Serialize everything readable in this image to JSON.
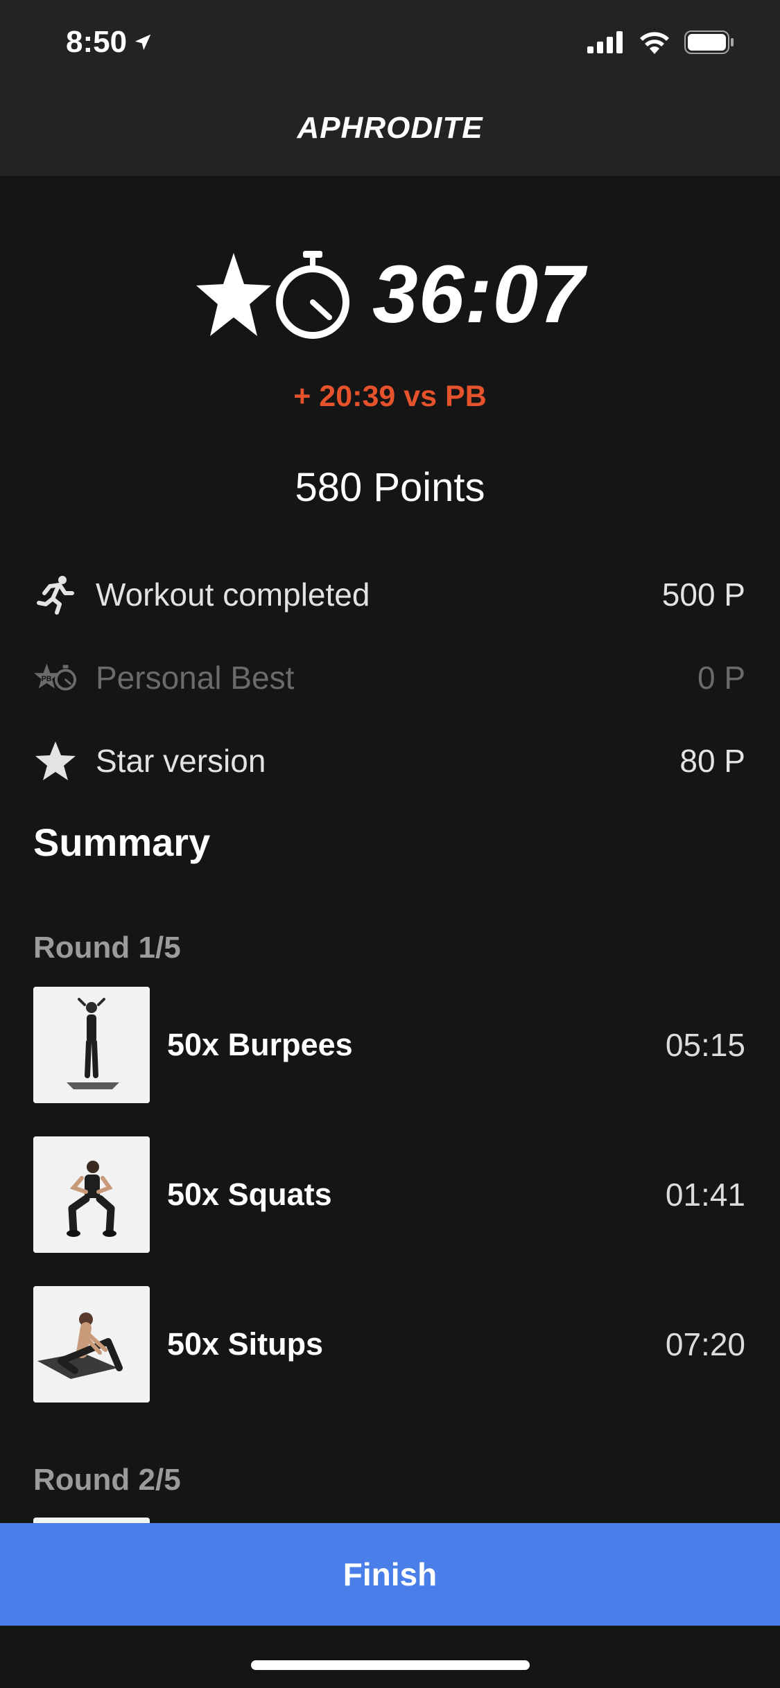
{
  "status_bar": {
    "time": "8:50"
  },
  "nav": {
    "title": "APHRODITE"
  },
  "result": {
    "time": "36:07",
    "vs_pb": "+ 20:39 vs PB",
    "points_total": "580 Points"
  },
  "points": [
    {
      "icon": "running-person-icon",
      "label": "Workout completed",
      "value": "500 P",
      "active": true
    },
    {
      "icon": "personal-best-icon",
      "label": "Personal Best",
      "value": "0 P",
      "active": false
    },
    {
      "icon": "star-icon",
      "label": "Star version",
      "value": "80 P",
      "active": true
    }
  ],
  "summary": {
    "title": "Summary",
    "rounds": [
      {
        "title": "Round 1/5",
        "exercises": [
          {
            "name": "50x Burpees",
            "time": "05:15"
          },
          {
            "name": "50x Squats",
            "time": "01:41"
          },
          {
            "name": "50x Situps",
            "time": "07:20"
          }
        ]
      },
      {
        "title": "Round 2/5",
        "exercises": []
      }
    ]
  },
  "actions": {
    "finish_label": "Finish"
  },
  "colors": {
    "accent_blue": "#4a7fea",
    "pb_red": "#e5522c",
    "background": "#151515"
  }
}
